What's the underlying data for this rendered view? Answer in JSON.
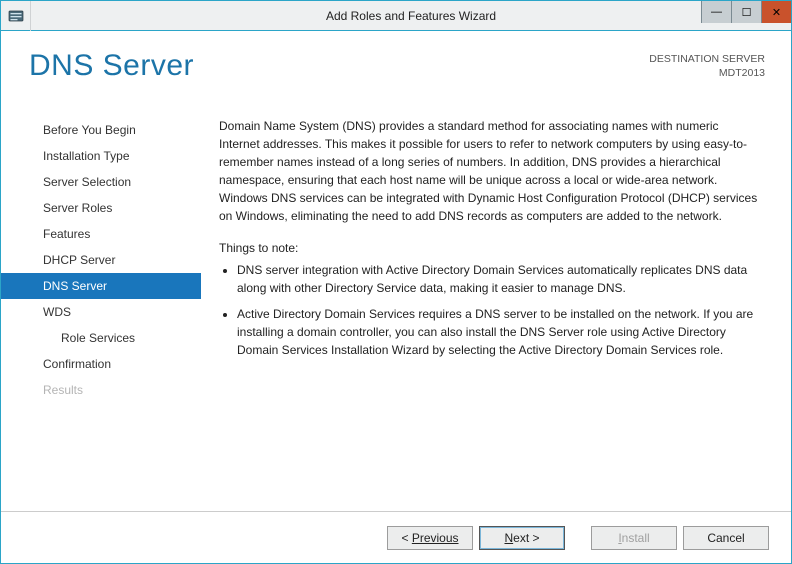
{
  "window": {
    "title": "Add Roles and Features Wizard"
  },
  "header": {
    "page_title": "DNS Server",
    "destination_label": "DESTINATION SERVER",
    "destination_name": "MDT2013"
  },
  "sidebar": {
    "items": [
      {
        "label": "Before You Begin",
        "selected": false,
        "disabled": false,
        "indent": false
      },
      {
        "label": "Installation Type",
        "selected": false,
        "disabled": false,
        "indent": false
      },
      {
        "label": "Server Selection",
        "selected": false,
        "disabled": false,
        "indent": false
      },
      {
        "label": "Server Roles",
        "selected": false,
        "disabled": false,
        "indent": false
      },
      {
        "label": "Features",
        "selected": false,
        "disabled": false,
        "indent": false
      },
      {
        "label": "DHCP Server",
        "selected": false,
        "disabled": false,
        "indent": false
      },
      {
        "label": "DNS Server",
        "selected": true,
        "disabled": false,
        "indent": false
      },
      {
        "label": "WDS",
        "selected": false,
        "disabled": false,
        "indent": false
      },
      {
        "label": "Role Services",
        "selected": false,
        "disabled": false,
        "indent": true
      },
      {
        "label": "Confirmation",
        "selected": false,
        "disabled": false,
        "indent": false
      },
      {
        "label": "Results",
        "selected": false,
        "disabled": true,
        "indent": false
      }
    ]
  },
  "main": {
    "para1": "Domain Name System (DNS) provides a standard method for associating names with numeric Internet addresses. This makes it possible for users to refer to network computers by using easy-to-remember names instead of a long series of numbers. In addition, DNS provides a hierarchical namespace, ensuring that each host name will be unique across a local or wide-area network. Windows DNS services can be integrated with Dynamic Host Configuration Protocol (DHCP) services on Windows, eliminating the need to add DNS records as computers are added to the network.",
    "note_heading": "Things to note:",
    "bullets": [
      "DNS server integration with Active Directory Domain Services automatically replicates DNS data along with other Directory Service data, making it easier to manage DNS.",
      "Active Directory Domain Services requires a DNS server to be installed on the network. If you are installing a domain controller, you can also install the DNS Server role using Active Directory Domain Services Installation Wizard by selecting the Active Directory Domain Services role."
    ]
  },
  "footer": {
    "previous": "Previous",
    "next": "Next >",
    "install": "Install",
    "cancel": "Cancel"
  }
}
